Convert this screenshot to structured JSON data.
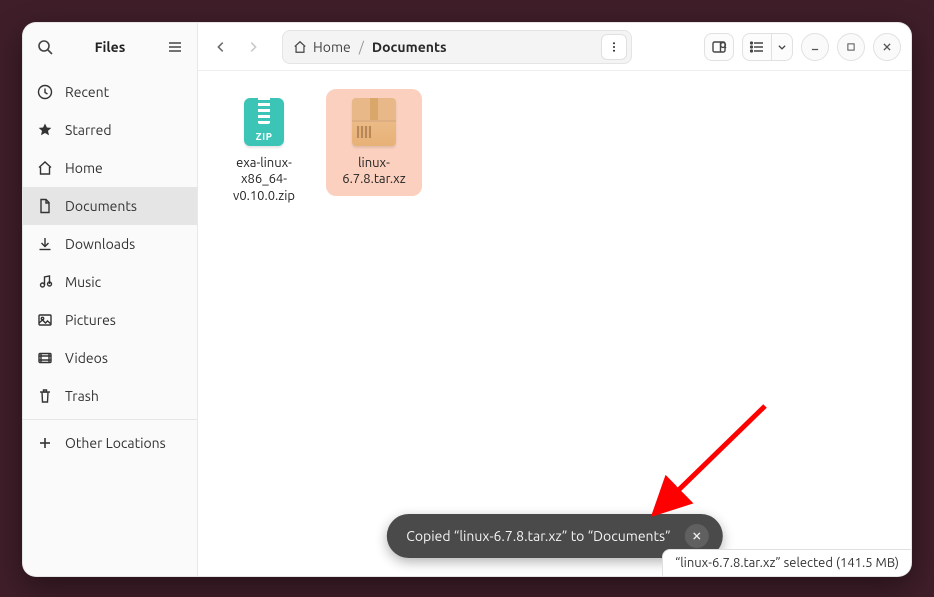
{
  "header": {
    "title": "Files"
  },
  "sidebar": {
    "items": [
      {
        "label": "Recent",
        "icon": "clock"
      },
      {
        "label": "Starred",
        "icon": "star"
      },
      {
        "label": "Home",
        "icon": "home"
      },
      {
        "label": "Documents",
        "icon": "document",
        "active": true
      },
      {
        "label": "Downloads",
        "icon": "download"
      },
      {
        "label": "Music",
        "icon": "music"
      },
      {
        "label": "Pictures",
        "icon": "image"
      },
      {
        "label": "Videos",
        "icon": "video"
      },
      {
        "label": "Trash",
        "icon": "trash"
      }
    ],
    "other_locations_label": "Other Locations"
  },
  "pathbar": {
    "home_label": "Home",
    "current_label": "Documents"
  },
  "files": [
    {
      "name": "exa-linux-x86_64-v0.10.0.zip",
      "type": "zip",
      "selected": false
    },
    {
      "name": "linux-6.7.8.tar.xz",
      "type": "tar",
      "selected": true
    }
  ],
  "toast": {
    "message": "Copied “linux-6.7.8.tar.xz” to “Documents”"
  },
  "statusbar": {
    "text": "“linux-6.7.8.tar.xz” selected  (141.5 MB)"
  }
}
